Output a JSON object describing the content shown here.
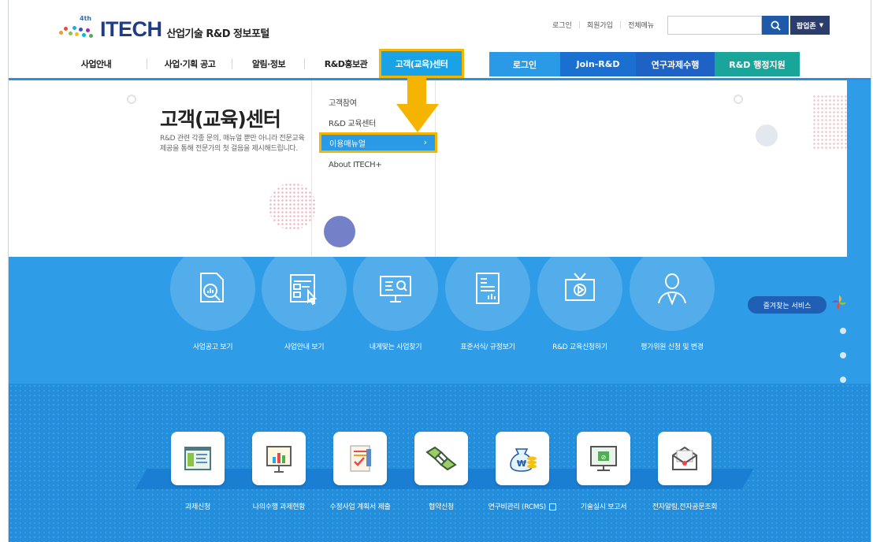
{
  "header": {
    "logo_badge": "4th",
    "logo_brand": "ITECH",
    "logo_sub": "산업기술 R&D 정보포털",
    "util_links": [
      "로그인",
      "회원가입",
      "전체메뉴"
    ],
    "search_placeholder": "",
    "popup_label": "팝업존"
  },
  "nav": {
    "items": [
      "사업안내",
      "사업·기획 공고",
      "알림·정보",
      "R&D홍보관",
      "고객(교육)센터"
    ],
    "right_items": [
      "로그인",
      "Join-R&D",
      "연구과제수행",
      "R&D 행정지원"
    ],
    "active": "고객(교육)센터"
  },
  "mega_menu": {
    "title": "고객(교육)센터",
    "description": "R&D 관련 각종 문의, 매뉴얼 뿐만 아니라 전문교육 제공을 통해 전문가의 첫 걸음을 제시해드립니다.",
    "sub_items": [
      "고객참여",
      "R&D 교육센터",
      "이용매뉴얼",
      "About ITECH+"
    ],
    "highlighted": "이용매뉴얼",
    "highlighted_arrow": "›"
  },
  "services": [
    {
      "label": "사업공고 보기",
      "icon": "search-document-icon"
    },
    {
      "label": "사업안내 보기",
      "icon": "click-document-icon"
    },
    {
      "label": "내게맞는 사업찾기",
      "icon": "monitor-search-icon"
    },
    {
      "label": "표준서식/ 규정보기",
      "icon": "form-document-icon"
    },
    {
      "label": "R&D 교육신청하기",
      "icon": "tv-play-icon"
    },
    {
      "label": "평가위원 신청 및 변경",
      "icon": "person-icon"
    }
  ],
  "favorites": {
    "label": "즐겨찾는 서비스"
  },
  "tasks": [
    {
      "label": "과제신청",
      "icon": "window-form-icon"
    },
    {
      "label": "나의수행 과제현황",
      "icon": "board-chart-icon"
    },
    {
      "label": "수정사업 계획서 제출",
      "icon": "checklist-icon"
    },
    {
      "label": "협약신청",
      "icon": "handshake-icon"
    },
    {
      "label": "연구비관리 (RCMS)",
      "icon": "money-bag-icon"
    },
    {
      "label": "기술실시 보고서",
      "icon": "monitor-report-icon"
    },
    {
      "label": "전자알림,전자공문조회",
      "icon": "envelope-icon"
    }
  ],
  "colors": {
    "brand": "#1f3c88",
    "primary_blue": "#2e9ce6",
    "highlight": "#f5b400",
    "nav_right": [
      "#2b9ae6",
      "#1a6fd0",
      "#1f62c6",
      "#1aa59a"
    ]
  }
}
